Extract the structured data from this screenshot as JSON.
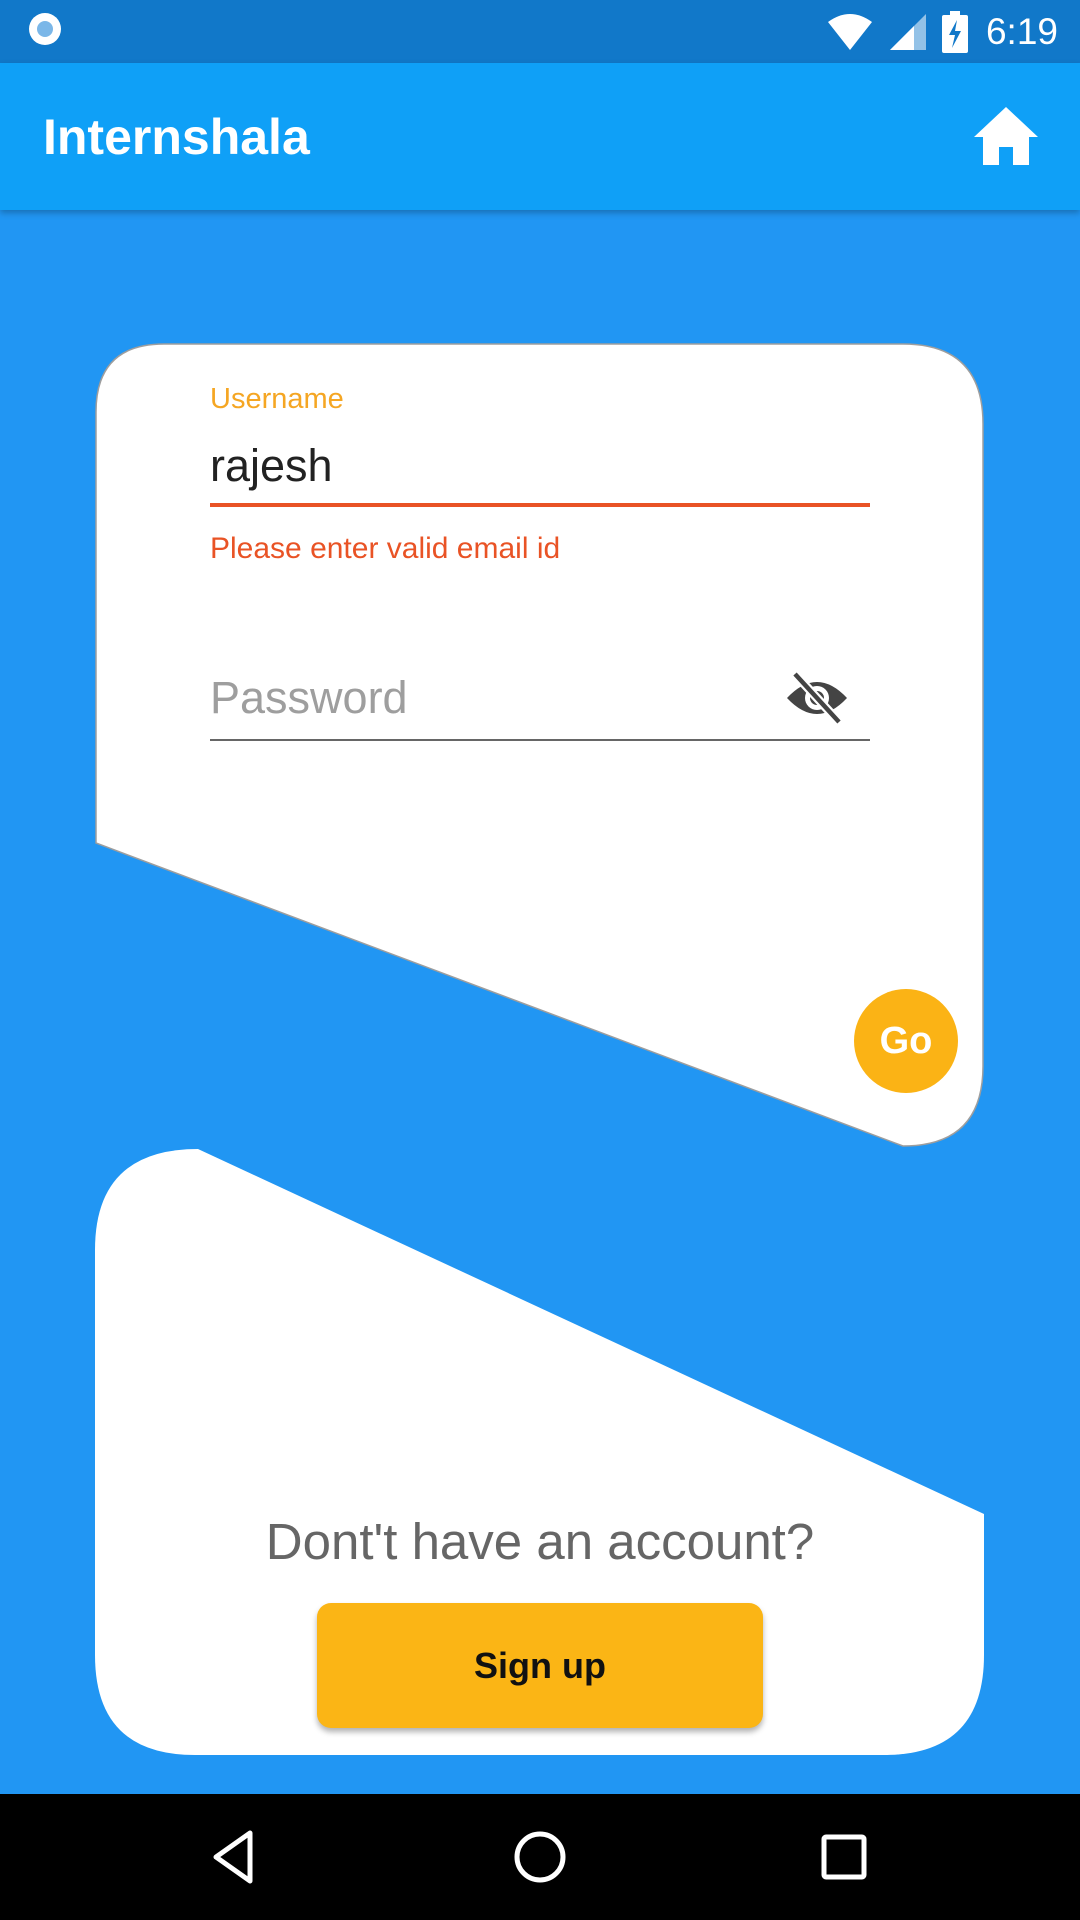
{
  "status_bar": {
    "time": "6:19",
    "icons": [
      "notification-dot-icon",
      "wifi-icon",
      "signal-icon",
      "battery-charging-icon"
    ]
  },
  "app_bar": {
    "title": "Internshala",
    "home_icon": "home-icon"
  },
  "login_form": {
    "username_label": "Username",
    "username_value": "rajesh",
    "username_error": "Please enter valid email id",
    "password_placeholder": "Password",
    "password_toggle_icon": "eye-off-icon",
    "go_label": "Go"
  },
  "signup_section": {
    "prompt": "Dont't have an account?",
    "signup_label": "Sign up"
  },
  "nav_bar": {
    "icons": [
      "back-icon",
      "home-circle-icon",
      "recents-icon"
    ]
  },
  "colors": {
    "background": "#2196F3",
    "app_bar": "#0FA0F7",
    "accent": "#FBB315",
    "error": "#E95325",
    "label": "#F5A623"
  }
}
